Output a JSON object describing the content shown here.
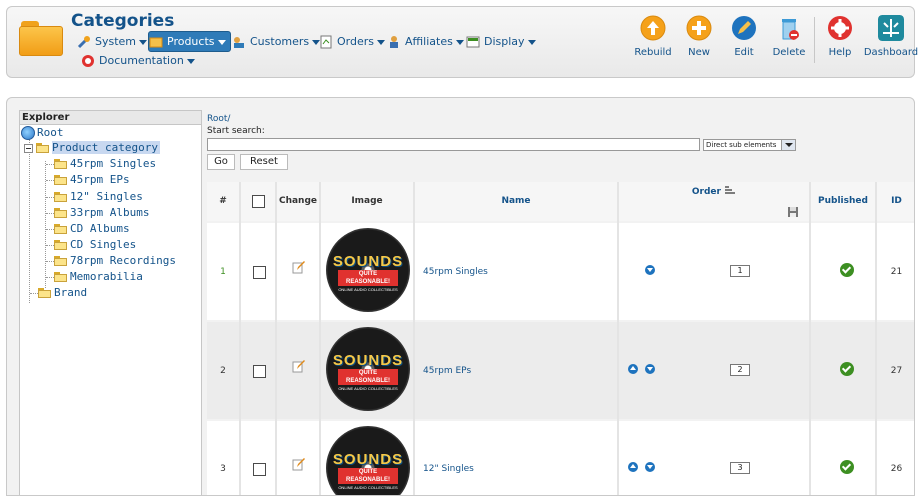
{
  "header": {
    "title": "Categories",
    "menu": [
      {
        "label": "System",
        "icon": "tools-icon"
      },
      {
        "label": "Products",
        "icon": "box-icon"
      },
      {
        "label": "Customers",
        "icon": "customers-icon"
      },
      {
        "label": "Orders",
        "icon": "orders-icon"
      },
      {
        "label": "Affiliates",
        "icon": "affiliates-icon"
      },
      {
        "label": "Display",
        "icon": "display-icon"
      },
      {
        "label": "Documentation",
        "icon": "lifebuoy-icon"
      }
    ],
    "toolbar": [
      {
        "label": "Rebuild",
        "icon": "rebuild-icon",
        "color": "#f5a11a"
      },
      {
        "label": "New",
        "icon": "plus-icon",
        "color": "#f5a11a"
      },
      {
        "label": "Edit",
        "icon": "pencil-icon",
        "color": "#1e73be"
      },
      {
        "label": "Delete",
        "icon": "trash-icon",
        "color": "#3d9ad6"
      },
      {
        "label": "Help",
        "icon": "lifebuoy-icon",
        "color": "#e0322f"
      },
      {
        "label": "Dashboard",
        "icon": "dashboard-icon",
        "color": "#1f8a9e"
      }
    ]
  },
  "explorer": {
    "title": "Explorer",
    "root": "Root",
    "selected": "Product category",
    "children": [
      "45rpm Singles",
      "45rpm EPs",
      "12\" Singles",
      "33rpm Albums",
      "CD Albums",
      "CD Singles",
      "78rpm Recordings",
      "Memorabilia"
    ],
    "sibling": "Brand"
  },
  "search": {
    "breadcrumb": "Root/",
    "label": "Start search:",
    "value": "",
    "scope": "Direct sub elements",
    "go_label": "Go",
    "reset_label": "Reset"
  },
  "table": {
    "headers": {
      "num": "#",
      "change": "Change",
      "image": "Image",
      "name": "Name",
      "order": "Order",
      "published": "Published",
      "id": "ID"
    },
    "rows": [
      {
        "num": "1",
        "name": "45rpm Singles",
        "order": "1",
        "id": "21",
        "image_text": [
          "SOUNDS",
          "QUITE REASONABLE!",
          "ONLINE AUDIO COLLECTIBLES"
        ]
      },
      {
        "num": "2",
        "name": "45rpm EPs",
        "order": "2",
        "id": "27",
        "image_text": [
          "SOUNDS",
          "QUITE REASONABLE!",
          "ONLINE AUDIO COLLECTIBLES"
        ]
      },
      {
        "num": "3",
        "name": "12\" Singles",
        "order": "3",
        "id": "26",
        "image_text": [
          "SOUNDS",
          "QUITE REASONABLE!",
          "ONLINE AUDIO COLLECTIBLES"
        ]
      }
    ]
  },
  "colors": {
    "accent": "#14538a",
    "active_menu": "#2f7bb8",
    "published": "#3d8f22"
  }
}
